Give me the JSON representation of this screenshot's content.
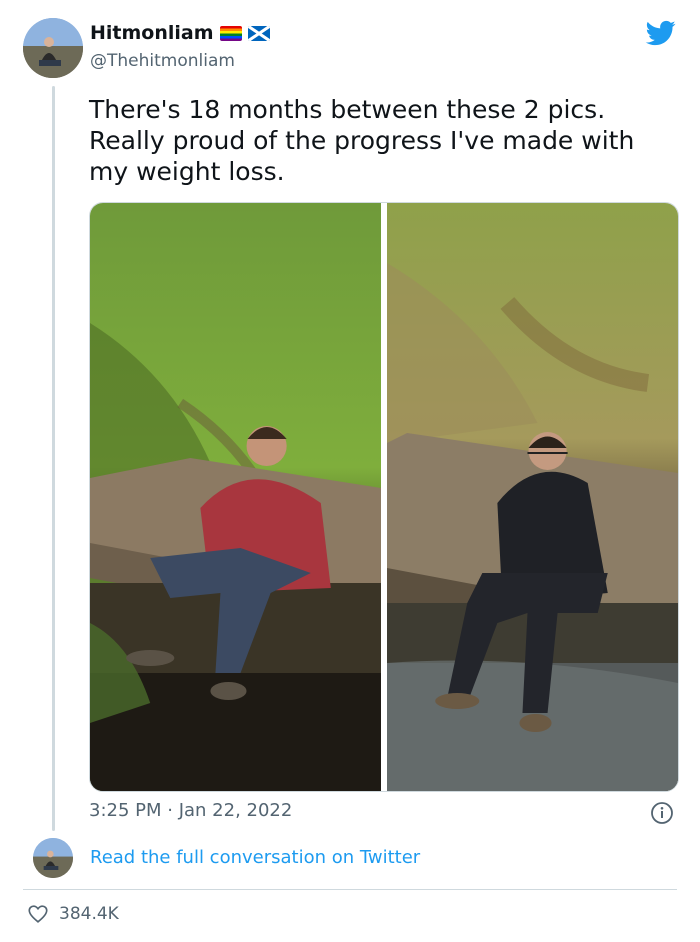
{
  "author": {
    "display_name": "Hitmonliam",
    "handle": "@Thehitmonliam",
    "avatar_icon": "avatar-photo",
    "flags": [
      "rainbow-pride-flag",
      "scotland-flag"
    ]
  },
  "tweet": {
    "text": "There's 18 months between these 2 pics. Really proud of the progress I've made with my weight loss.",
    "media": [
      {
        "name": "before-photo",
        "icon": "photo"
      },
      {
        "name": "after-photo",
        "icon": "photo"
      }
    ],
    "timestamp": "3:25 PM · Jan 22, 2022"
  },
  "footer": {
    "read_link": "Read the full conversation on Twitter",
    "likes": "384.4K"
  },
  "colors": {
    "link_blue": "#1d9bf0",
    "secondary_text": "#536471",
    "border": "#cfd9de"
  }
}
